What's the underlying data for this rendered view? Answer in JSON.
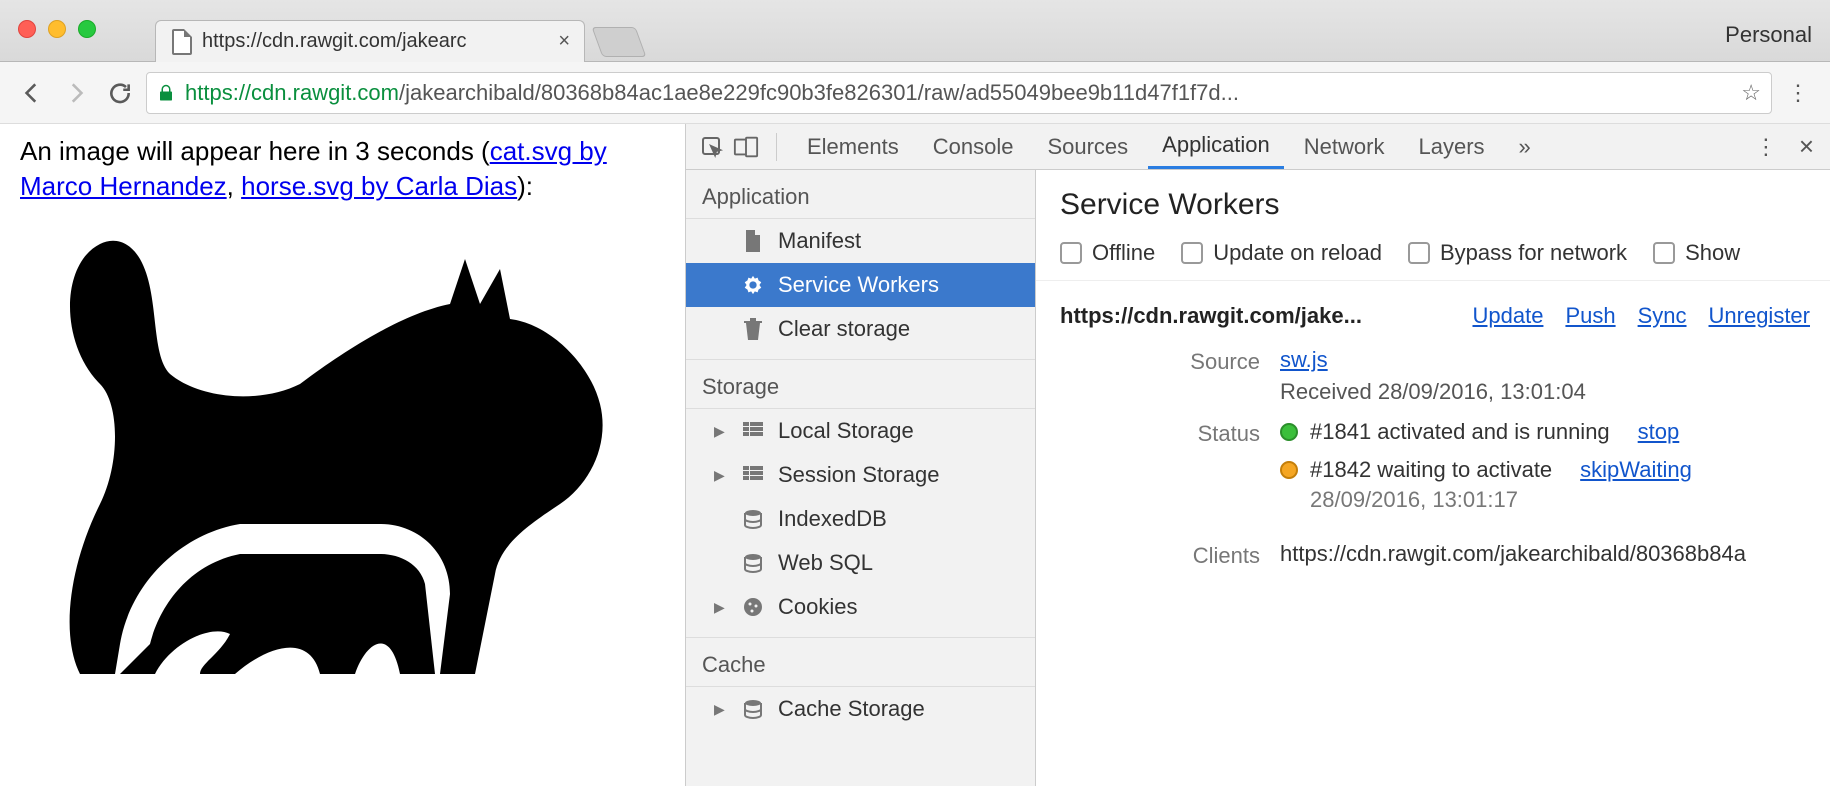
{
  "window": {
    "profile": "Personal",
    "tab_title": "https://cdn.rawgit.com/jakearc",
    "url_scheme": "https",
    "url_host": "://cdn.rawgit.com",
    "url_path": "/jakearchibald/80368b84ac1ae8e229fc90b3fe826301/raw/ad55049bee9b11d47f1f7d..."
  },
  "page": {
    "text_prefix": "An image will appear here in 3 seconds (",
    "link1": "cat.svg by Marco Hernandez",
    "sep": ", ",
    "link2": "horse.svg by Carla Dias",
    "text_suffix": "):"
  },
  "devtools": {
    "tabs": [
      "Elements",
      "Console",
      "Sources",
      "Application",
      "Network",
      "Layers"
    ],
    "active_tab": "Application",
    "overflow": "»"
  },
  "sidebar": {
    "groups": [
      {
        "title": "Application",
        "items": [
          {
            "label": "Manifest",
            "icon": "file"
          },
          {
            "label": "Service Workers",
            "icon": "gear",
            "selected": true
          },
          {
            "label": "Clear storage",
            "icon": "trash"
          }
        ]
      },
      {
        "title": "Storage",
        "items": [
          {
            "label": "Local Storage",
            "icon": "grid",
            "expandable": true
          },
          {
            "label": "Session Storage",
            "icon": "grid",
            "expandable": true
          },
          {
            "label": "IndexedDB",
            "icon": "db"
          },
          {
            "label": "Web SQL",
            "icon": "db"
          },
          {
            "label": "Cookies",
            "icon": "cookie",
            "expandable": true
          }
        ]
      },
      {
        "title": "Cache",
        "items": [
          {
            "label": "Cache Storage",
            "icon": "db",
            "expandable": true
          }
        ]
      }
    ]
  },
  "panel": {
    "title": "Service Workers",
    "options": [
      "Offline",
      "Update on reload",
      "Bypass for network",
      "Show"
    ],
    "origin": "https://cdn.rawgit.com/jake...",
    "action_links": [
      "Update",
      "Push",
      "Sync",
      "Unregister"
    ],
    "source_label": "Source",
    "source_file": "sw.js",
    "received": "Received 28/09/2016, 13:01:04",
    "status_label": "Status",
    "status1_text": "#1841 activated and is running",
    "status1_action": "stop",
    "status2_text": "#1842 waiting to activate",
    "status2_action": "skipWaiting",
    "status2_time": "28/09/2016, 13:01:17",
    "clients_label": "Clients",
    "clients_value": "https://cdn.rawgit.com/jakearchibald/80368b84a"
  }
}
